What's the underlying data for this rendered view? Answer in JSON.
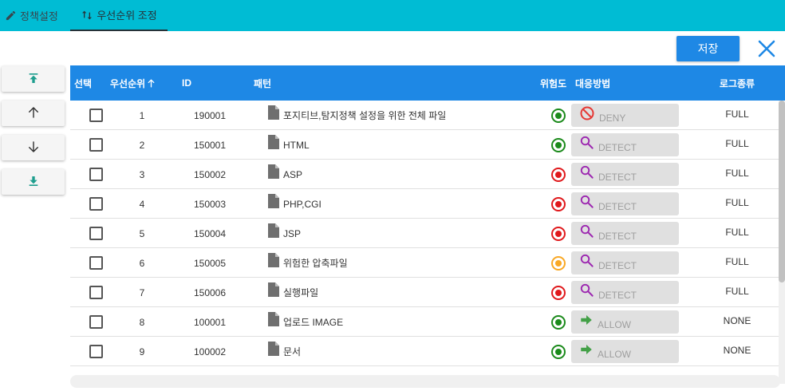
{
  "tabs": [
    {
      "label": "정책설정",
      "icon": "pencil-icon",
      "active": false
    },
    {
      "label": "우선순위 조정",
      "icon": "sort-arrows-icon",
      "active": true
    }
  ],
  "toolbar": {
    "save_label": "저장",
    "close_icon": "close-icon"
  },
  "move_buttons": [
    {
      "icon": "move-to-top-icon"
    },
    {
      "icon": "arrow-up-icon"
    },
    {
      "icon": "arrow-down-icon"
    },
    {
      "icon": "move-to-bottom-icon"
    }
  ],
  "table": {
    "headers": {
      "select": "선택",
      "priority": "우선순위",
      "id": "ID",
      "pattern": "패턴",
      "risk": "위험도",
      "action": "대응방법",
      "log_type": "로그종류"
    },
    "sort_icon": "arrow-up-icon",
    "rows": [
      {
        "priority": "1",
        "id": "190001",
        "pattern": "포지티브,탐지정책 설정을 위한 전체 파일",
        "risk": "green",
        "action": "DENY",
        "action_icon": "deny-icon",
        "log_type": "FULL"
      },
      {
        "priority": "2",
        "id": "150001",
        "pattern": "HTML",
        "risk": "green",
        "action": "DETECT",
        "action_icon": "magnifier-icon",
        "log_type": "FULL"
      },
      {
        "priority": "3",
        "id": "150002",
        "pattern": "ASP",
        "risk": "red",
        "action": "DETECT",
        "action_icon": "magnifier-icon",
        "log_type": "FULL"
      },
      {
        "priority": "4",
        "id": "150003",
        "pattern": "PHP,CGI",
        "risk": "red",
        "action": "DETECT",
        "action_icon": "magnifier-icon",
        "log_type": "FULL"
      },
      {
        "priority": "5",
        "id": "150004",
        "pattern": "JSP",
        "risk": "red",
        "action": "DETECT",
        "action_icon": "magnifier-icon",
        "log_type": "FULL"
      },
      {
        "priority": "6",
        "id": "150005",
        "pattern": "위험한 압축파일",
        "risk": "orange",
        "action": "DETECT",
        "action_icon": "magnifier-icon",
        "log_type": "FULL"
      },
      {
        "priority": "7",
        "id": "150006",
        "pattern": "실행파일",
        "risk": "red",
        "action": "DETECT",
        "action_icon": "magnifier-icon",
        "log_type": "FULL"
      },
      {
        "priority": "8",
        "id": "100001",
        "pattern": "업로드 IMAGE",
        "risk": "green",
        "action": "ALLOW",
        "action_icon": "arrow-right-icon",
        "log_type": "NONE"
      },
      {
        "priority": "9",
        "id": "100002",
        "pattern": "문서",
        "risk": "green",
        "action": "ALLOW",
        "action_icon": "arrow-right-icon",
        "log_type": "NONE"
      }
    ]
  },
  "colors": {
    "tab_bar": "#00bcd4",
    "header": "#1e88e5",
    "save_button": "#1e88e5",
    "risk_green": "#1b8a1b",
    "risk_red": "#e0191c",
    "risk_orange": "#f9a825",
    "deny": "#e53935",
    "detect": "#9c27b0",
    "allow": "#43a047"
  }
}
